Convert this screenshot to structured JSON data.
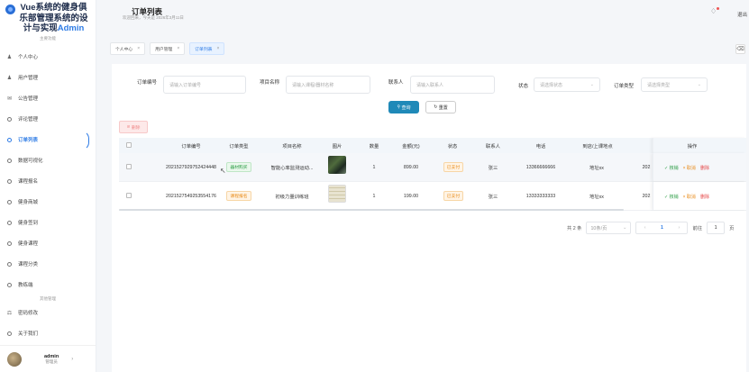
{
  "brand": {
    "title_line1": "Vue系统的健身俱",
    "title_line2": "乐部管理系统的设",
    "title_line3": "计与实现",
    "title_accent": "Admin",
    "caption": "主要功能"
  },
  "sidebar": {
    "items": [
      {
        "label": "个人中心",
        "icon": "person-icon"
      },
      {
        "label": "用户管理",
        "icon": "users-icon"
      },
      {
        "label": "公告管理",
        "icon": "megaphone-icon"
      },
      {
        "label": "评论管理",
        "icon": "circle-icon"
      },
      {
        "label": "订单列表",
        "icon": "circle-icon",
        "active": true
      },
      {
        "label": "数据可视化",
        "icon": "circle-icon"
      },
      {
        "label": "课程报名",
        "icon": "circle-icon"
      },
      {
        "label": "健身商城",
        "icon": "circle-icon"
      },
      {
        "label": "健身签到",
        "icon": "circle-icon"
      },
      {
        "label": "健身课程",
        "icon": "circle-icon"
      },
      {
        "label": "课程分类",
        "icon": "circle-icon"
      },
      {
        "label": "教练端",
        "icon": "circle-icon"
      }
    ],
    "section_caption": "其他管理",
    "items2": [
      {
        "label": "密码修改",
        "icon": "lock-icon"
      },
      {
        "label": "关于我们",
        "icon": "circle-icon"
      }
    ]
  },
  "user": {
    "name": "admin",
    "role": "管理员",
    "chevron": "›"
  },
  "header": {
    "title": "订单列表",
    "subtitle": "欢迎回来，今天是 2026年3月11日",
    "logout": "退出"
  },
  "tabs": [
    {
      "label": "个人中心",
      "close": "×"
    },
    {
      "label": "用户管理",
      "close": "×"
    },
    {
      "label": "订单列表",
      "close": "×",
      "active": true
    }
  ],
  "filters": {
    "order_no_label": "订单编号",
    "order_no_placeholder": "请输入订单编号",
    "course_label": "项目名称",
    "course_placeholder": "请输入课程/器材名称",
    "contact_label": "联系人",
    "contact_placeholder": "请输入联系人",
    "status_label": "状态",
    "status_placeholder": "请选择状态",
    "type_label": "订单类型",
    "type_placeholder": "请选择类型",
    "query_button": "查询",
    "reset_button": "重置",
    "delete_button": "删除"
  },
  "table": {
    "headers": [
      "订单编号",
      "订单类型",
      "项目名称",
      "图片",
      "数量",
      "金额(元)",
      "状态",
      "联系人",
      "电话",
      "到店/上课地点",
      "操作"
    ],
    "rows": [
      {
        "order_no": "2021527929752424448",
        "type": "器材购买",
        "type_color": "green",
        "item": "智能心率监测运动...",
        "image": "photo-dark",
        "qty": "1",
        "amount": "899.00",
        "status": "已支付",
        "contact": "张三",
        "phone": "13366666666",
        "place": "地址xx",
        "extra": "202"
      },
      {
        "order_no": "2021527549253554176",
        "type": "课程报名",
        "type_color": "orange",
        "item": "初级力量训练班",
        "image": "photo-doc",
        "qty": "1",
        "amount": "199.00",
        "status": "已支付",
        "contact": "张三",
        "phone": "13333333333",
        "place": "地址xx",
        "extra": "202"
      }
    ],
    "ops": {
      "view": "核销",
      "cancel": "取消",
      "del": "删除"
    }
  },
  "pager": {
    "total": "共 2 条",
    "size": "10条/页",
    "prev": "‹",
    "page": "1",
    "next": "›",
    "goto": "前往",
    "goto_page": "1",
    "unit": "页"
  }
}
